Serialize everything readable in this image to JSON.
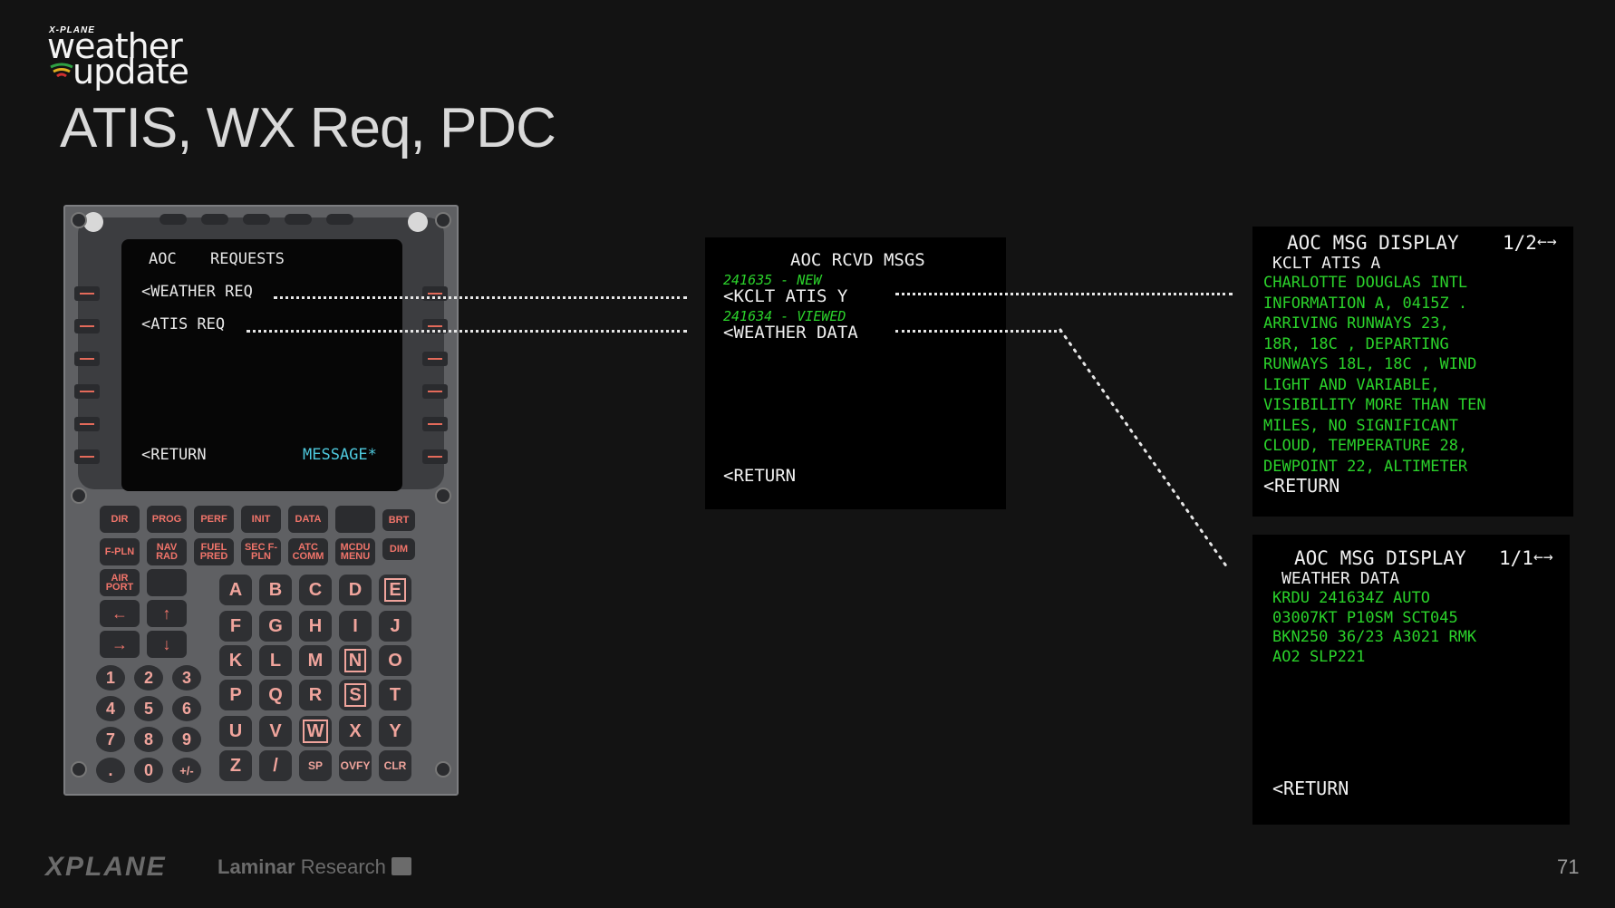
{
  "logo": {
    "brand_small": "X-PLANE",
    "line1": "weather",
    "line2": "update"
  },
  "slide_title": "ATIS, WX Req, PDC",
  "mcdu": {
    "title_left": "AOC",
    "title_right": "REQUESTS",
    "lines": [
      "<WEATHER REQ",
      "<ATIS REQ"
    ],
    "return_label": "<RETURN",
    "message_label": "MESSAGE*",
    "function_keys_row1": [
      "DIR",
      "PROG",
      "PERF",
      "INIT",
      "DATA",
      "",
      "BRT"
    ],
    "function_keys_row2": [
      "F-PLN",
      "NAV RAD",
      "FUEL PRED",
      "SEC F-PLN",
      "ATC COMM",
      "MCDU MENU",
      "DIM"
    ],
    "airport_key": "AIR PORT",
    "alpha_keys": [
      "A",
      "B",
      "C",
      "D",
      "E",
      "F",
      "G",
      "H",
      "I",
      "J",
      "K",
      "L",
      "M",
      "N",
      "O",
      "P",
      "Q",
      "R",
      "S",
      "T",
      "U",
      "V",
      "W",
      "X",
      "Y",
      "Z",
      "/",
      "SP",
      "OVFY",
      "CLR"
    ],
    "num_keys": [
      "1",
      "2",
      "3",
      "4",
      "5",
      "6",
      "7",
      "8",
      "9",
      ".",
      "0",
      "+/-"
    ]
  },
  "rcvd_msgs": {
    "title": "AOC RCVD MSGS",
    "items": [
      {
        "status": "241635 - NEW",
        "label": "<KCLT ATIS Y"
      },
      {
        "status": "241634 - VIEWED",
        "label": "<WEATHER DATA"
      }
    ],
    "return_label": "<RETURN"
  },
  "msg_display_1": {
    "title": "AOC MSG DISPLAY",
    "page": "1/2",
    "subtitle": "KCLT ATIS A",
    "body": [
      "CHARLOTTE DOUGLAS INTL",
      "INFORMATION A, 0415Z .",
      "ARRIVING RUNWAYS 23,",
      "18R, 18C , DEPARTING",
      "RUNWAYS 18L, 18C , WIND",
      "LIGHT AND VARIABLE,",
      "VISIBILITY MORE THAN TEN",
      "MILES, NO SIGNIFICANT",
      "CLOUD, TEMPERATURE 28,",
      "DEWPOINT 22, ALTIMETER"
    ],
    "return_label": "<RETURN"
  },
  "msg_display_2": {
    "title": "AOC MSG DISPLAY",
    "page": "1/1",
    "subtitle": "WEATHER DATA",
    "body": [
      "KRDU 241634Z AUTO",
      "03007KT P10SM SCT045",
      "BKN250 36/23 A3021 RMK",
      "AO2 SLP221"
    ],
    "return_label": "<RETURN"
  },
  "footer": {
    "brand": "XPLANE",
    "company_bold": "Laminar",
    "company_light": "Research",
    "page_number": "71"
  },
  "colors": {
    "background": "#131313",
    "screen_green": "#2bd22b",
    "screen_cyan": "#4ec9dd",
    "key_red": "#f0746a"
  }
}
